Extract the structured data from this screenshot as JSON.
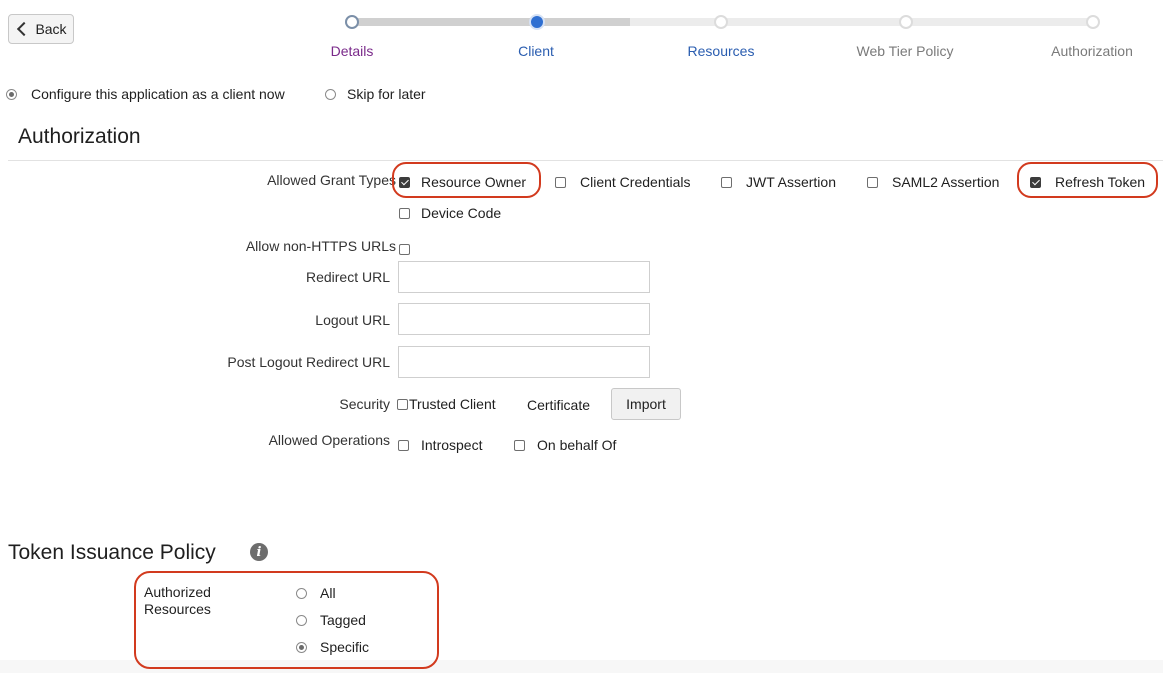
{
  "back_button": {
    "label": "Back"
  },
  "train": {
    "steps": [
      {
        "label": "Details",
        "state": "visited"
      },
      {
        "label": "Client",
        "state": "current"
      },
      {
        "label": "Resources",
        "state": "next"
      },
      {
        "label": "Web Tier Policy",
        "state": "disabled"
      },
      {
        "label": "Authorization",
        "state": "disabled"
      }
    ]
  },
  "client_choice": {
    "configure_now": {
      "label": "Configure this application as a client now",
      "selected": true
    },
    "skip": {
      "label": "Skip for later",
      "selected": false
    }
  },
  "authorization": {
    "title": "Authorization",
    "grant_types": {
      "label": "Allowed Grant Types",
      "options": [
        {
          "label": "Resource Owner",
          "checked": true
        },
        {
          "label": "Client Credentials",
          "checked": false
        },
        {
          "label": "JWT Assertion",
          "checked": false
        },
        {
          "label": "SAML2 Assertion",
          "checked": false
        },
        {
          "label": "Refresh Token",
          "checked": true
        },
        {
          "label": "Device Code",
          "checked": false
        }
      ]
    },
    "allow_non_https": {
      "label": "Allow non-HTTPS URLs",
      "checked": false
    },
    "redirect_url": {
      "label": "Redirect URL",
      "value": ""
    },
    "logout_url": {
      "label": "Logout URL",
      "value": ""
    },
    "post_logout_redirect_url": {
      "label": "Post Logout Redirect URL",
      "value": ""
    },
    "security": {
      "label": "Security",
      "trusted_client": {
        "label": "Trusted Client",
        "checked": false
      },
      "certificate_label": "Certificate",
      "import_label": "Import"
    },
    "allowed_operations": {
      "label": "Allowed Operations",
      "introspect": {
        "label": "Introspect",
        "checked": false
      },
      "on_behalf_of": {
        "label": "On behalf Of",
        "checked": false
      }
    }
  },
  "token_policy": {
    "title": "Token Issuance Policy",
    "info_icon": "info-icon",
    "authorized_resources": {
      "label_line1": "Authorized",
      "label_line2": "Resources",
      "options": [
        {
          "label": "All",
          "selected": false
        },
        {
          "label": "Tagged",
          "selected": false
        },
        {
          "label": "Specific",
          "selected": true
        }
      ]
    }
  },
  "colors": {
    "highlight": "#d23a1e",
    "current_step": "#2f6fd1",
    "visited_label": "#7a2a8a",
    "active_label": "#2a5db0"
  }
}
